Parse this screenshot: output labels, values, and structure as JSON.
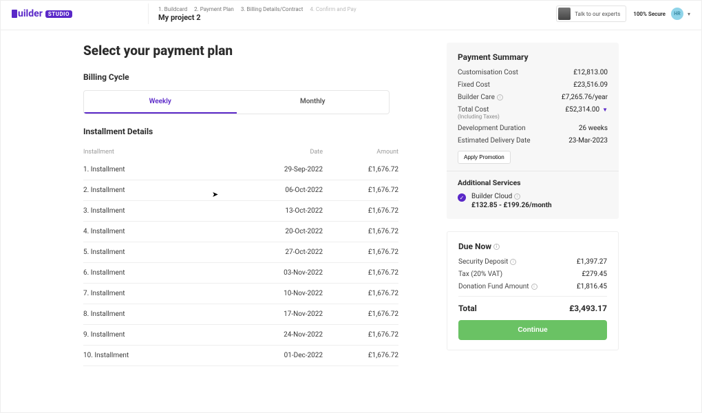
{
  "brand": {
    "name": "uilder",
    "badge": "STUDIO"
  },
  "header": {
    "breadcrumbs": [
      "1. Buildcard",
      "2. Payment Plan",
      "3. Billing Details/Contract",
      "4. Confirm and Pay"
    ],
    "breadcrumb_active_index": 2,
    "project_name": "My project 2",
    "experts_label": "Talk to our experts",
    "secure_label": "100% Secure",
    "user_initials": "HR"
  },
  "page_title": "Select your payment plan",
  "billing_cycle": {
    "label": "Billing Cycle",
    "tabs": [
      "Weekly",
      "Monthly"
    ],
    "active_tab": "Weekly"
  },
  "installments": {
    "label": "Installment Details",
    "columns": {
      "a": "Installment",
      "b": "Date",
      "c": "Amount"
    },
    "rows": [
      {
        "name": "1. Installment",
        "date": "29-Sep-2022",
        "amount": "£1,676.72"
      },
      {
        "name": "2. Installment",
        "date": "06-Oct-2022",
        "amount": "£1,676.72"
      },
      {
        "name": "3. Installment",
        "date": "13-Oct-2022",
        "amount": "£1,676.72"
      },
      {
        "name": "4. Installment",
        "date": "20-Oct-2022",
        "amount": "£1,676.72"
      },
      {
        "name": "5. Installment",
        "date": "27-Oct-2022",
        "amount": "£1,676.72"
      },
      {
        "name": "6. Installment",
        "date": "03-Nov-2022",
        "amount": "£1,676.72"
      },
      {
        "name": "7. Installment",
        "date": "10-Nov-2022",
        "amount": "£1,676.72"
      },
      {
        "name": "8. Installment",
        "date": "17-Nov-2022",
        "amount": "£1,676.72"
      },
      {
        "name": "9. Installment",
        "date": "24-Nov-2022",
        "amount": "£1,676.72"
      },
      {
        "name": "10. Installment",
        "date": "01-Dec-2022",
        "amount": "£1,676.72"
      }
    ]
  },
  "summary": {
    "title": "Payment Summary",
    "items": {
      "customisation": {
        "label": "Customisation Cost",
        "value": "£12,813.00"
      },
      "fixed": {
        "label": "Fixed Cost",
        "value": "£23,516.09"
      },
      "care": {
        "label": "Builder Care",
        "value": "£7,265.76/year"
      },
      "total": {
        "label": "Total Cost",
        "sublabel": "(Including Taxes)",
        "value": "£52,314.00"
      },
      "duration": {
        "label": "Development Duration",
        "value": "26 weeks"
      },
      "delivery": {
        "label": "Estimated Delivery Date",
        "value": "23-Mar-2023"
      }
    },
    "promo_button": "Apply Promotion"
  },
  "additional_services": {
    "title": "Additional Services",
    "service": {
      "name": "Builder Cloud",
      "price": "£132.85 - £199.26/month",
      "checked": true
    }
  },
  "due_now": {
    "title": "Due Now",
    "rows": {
      "deposit": {
        "label": "Security Deposit",
        "value": "£1,397.27"
      },
      "tax": {
        "label": "Tax (20% VAT)",
        "value": "£279.45"
      },
      "donation": {
        "label": "Donation Fund Amount",
        "value": "£1,816.45"
      }
    },
    "total": {
      "label": "Total",
      "value": "£3,493.17"
    },
    "continue_label": "Continue"
  }
}
